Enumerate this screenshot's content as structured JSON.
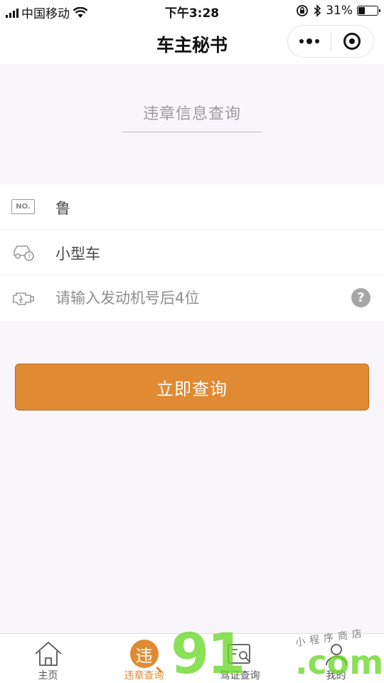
{
  "status_bar": {
    "carrier": "中国移动",
    "time": "下午3:28",
    "battery": "31%",
    "battery_level": 0.31
  },
  "nav": {
    "title": "车主秘书"
  },
  "form": {
    "section_title": "违章信息查询",
    "plate_badge": "NO.",
    "plate_prefix": "鲁",
    "car_type": "小型车",
    "engine_placeholder": "请输入发动机号后4位",
    "help_symbol": "?"
  },
  "query_button": "立即查询",
  "tabs": [
    {
      "label": "主页",
      "icon": "home-icon",
      "active": false
    },
    {
      "label": "违章查询",
      "icon": "violation-icon",
      "icon_char": "违",
      "active": true
    },
    {
      "label": "驾证查询",
      "icon": "license-icon",
      "active": false
    },
    {
      "label": "我的",
      "icon": "user-icon",
      "active": false
    }
  ],
  "watermark": {
    "main": "91",
    "suffix": ".com",
    "caption": "小程序商店"
  },
  "colors": {
    "accent": "#e08a34",
    "background": "#f8f6fb"
  }
}
